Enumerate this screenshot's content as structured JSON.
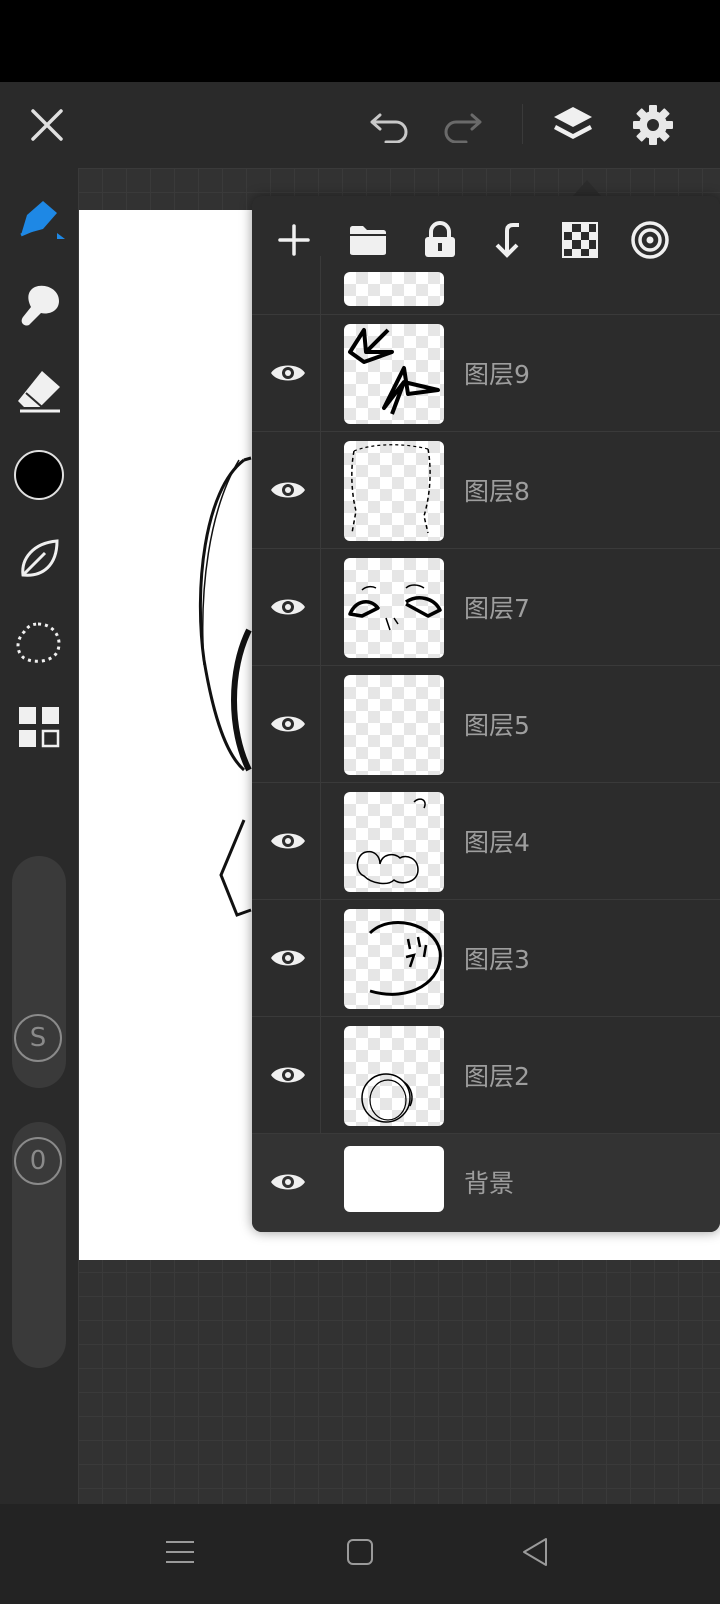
{
  "topbar": {
    "close_icon": "close-icon",
    "undo_icon": "undo-icon",
    "redo_icon": "redo-icon",
    "layers_icon": "layers-icon",
    "settings_icon": "gear-icon"
  },
  "sidebar": {
    "tools": [
      "pen-icon",
      "smudge-icon",
      "eraser-icon",
      "color-swatch",
      "leaf-icon",
      "lasso-icon",
      "grid-icon"
    ],
    "active_color": "#000000",
    "accent": "#1e88e5",
    "size_label": "S",
    "opacity_label": "0"
  },
  "layers_panel": {
    "toolbar": [
      "add-icon",
      "folder-icon",
      "lock-icon",
      "merge-down-icon",
      "checker-icon",
      "target-icon"
    ],
    "layers": [
      {
        "name": "图层9"
      },
      {
        "name": "图层8"
      },
      {
        "name": "图层7"
      },
      {
        "name": "图层5"
      },
      {
        "name": "图层4"
      },
      {
        "name": "图层3"
      },
      {
        "name": "图层2"
      },
      {
        "name": "背景"
      }
    ]
  },
  "navbar": {
    "menu_icon": "menu-icon",
    "home_icon": "home-icon",
    "back_icon": "back-icon"
  }
}
